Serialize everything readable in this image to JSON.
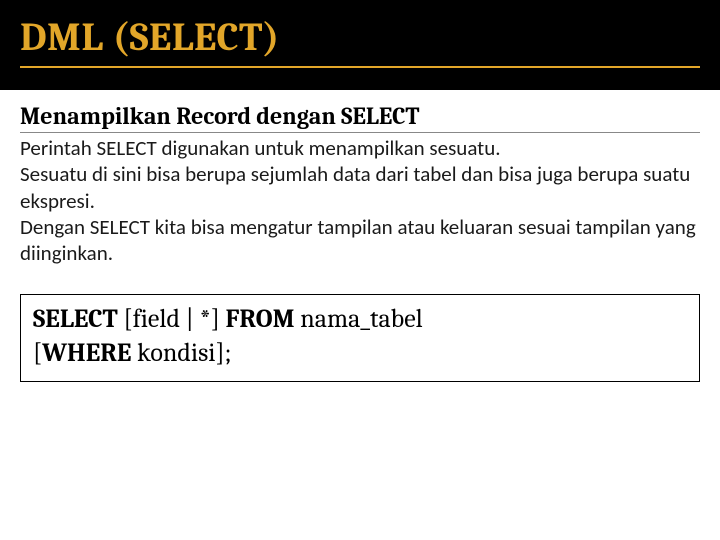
{
  "slide": {
    "title": "DML (SELECT)",
    "heading": "Menampilkan Record dengan SELECT",
    "body_line1": "Perintah SELECT digunakan untuk menampilkan sesuatu.",
    "body_line2": "Sesuatu di sini  bisa berupa sejumlah data dari tabel  dan bisa juga berupa suatu ekspresi.",
    "body_line3": "Dengan SELECT kita bisa mengatur tampilan atau keluaran sesuai tampilan yang diinginkan.",
    "syntax": {
      "kw_select": "SELECT",
      "fields": " [field | *] ",
      "kw_from": "FROM",
      "table": " nama_tabel ",
      "opt_open": "[",
      "kw_where": "WHERE",
      "cond": " kondisi",
      "opt_close": "];"
    }
  }
}
